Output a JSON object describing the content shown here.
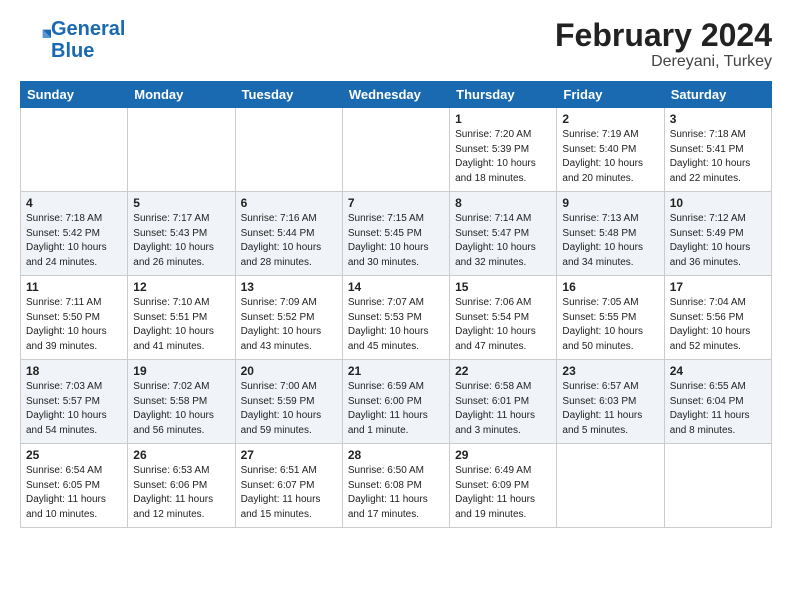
{
  "header": {
    "logo_line1": "General",
    "logo_line2": "Blue",
    "title": "February 2024",
    "subtitle": "Dereyani, Turkey"
  },
  "days_of_week": [
    "Sunday",
    "Monday",
    "Tuesday",
    "Wednesday",
    "Thursday",
    "Friday",
    "Saturday"
  ],
  "weeks": [
    [
      {
        "day": "",
        "info": ""
      },
      {
        "day": "",
        "info": ""
      },
      {
        "day": "",
        "info": ""
      },
      {
        "day": "",
        "info": ""
      },
      {
        "day": "1",
        "info": "Sunrise: 7:20 AM\nSunset: 5:39 PM\nDaylight: 10 hours\nand 18 minutes."
      },
      {
        "day": "2",
        "info": "Sunrise: 7:19 AM\nSunset: 5:40 PM\nDaylight: 10 hours\nand 20 minutes."
      },
      {
        "day": "3",
        "info": "Sunrise: 7:18 AM\nSunset: 5:41 PM\nDaylight: 10 hours\nand 22 minutes."
      }
    ],
    [
      {
        "day": "4",
        "info": "Sunrise: 7:18 AM\nSunset: 5:42 PM\nDaylight: 10 hours\nand 24 minutes."
      },
      {
        "day": "5",
        "info": "Sunrise: 7:17 AM\nSunset: 5:43 PM\nDaylight: 10 hours\nand 26 minutes."
      },
      {
        "day": "6",
        "info": "Sunrise: 7:16 AM\nSunset: 5:44 PM\nDaylight: 10 hours\nand 28 minutes."
      },
      {
        "day": "7",
        "info": "Sunrise: 7:15 AM\nSunset: 5:45 PM\nDaylight: 10 hours\nand 30 minutes."
      },
      {
        "day": "8",
        "info": "Sunrise: 7:14 AM\nSunset: 5:47 PM\nDaylight: 10 hours\nand 32 minutes."
      },
      {
        "day": "9",
        "info": "Sunrise: 7:13 AM\nSunset: 5:48 PM\nDaylight: 10 hours\nand 34 minutes."
      },
      {
        "day": "10",
        "info": "Sunrise: 7:12 AM\nSunset: 5:49 PM\nDaylight: 10 hours\nand 36 minutes."
      }
    ],
    [
      {
        "day": "11",
        "info": "Sunrise: 7:11 AM\nSunset: 5:50 PM\nDaylight: 10 hours\nand 39 minutes."
      },
      {
        "day": "12",
        "info": "Sunrise: 7:10 AM\nSunset: 5:51 PM\nDaylight: 10 hours\nand 41 minutes."
      },
      {
        "day": "13",
        "info": "Sunrise: 7:09 AM\nSunset: 5:52 PM\nDaylight: 10 hours\nand 43 minutes."
      },
      {
        "day": "14",
        "info": "Sunrise: 7:07 AM\nSunset: 5:53 PM\nDaylight: 10 hours\nand 45 minutes."
      },
      {
        "day": "15",
        "info": "Sunrise: 7:06 AM\nSunset: 5:54 PM\nDaylight: 10 hours\nand 47 minutes."
      },
      {
        "day": "16",
        "info": "Sunrise: 7:05 AM\nSunset: 5:55 PM\nDaylight: 10 hours\nand 50 minutes."
      },
      {
        "day": "17",
        "info": "Sunrise: 7:04 AM\nSunset: 5:56 PM\nDaylight: 10 hours\nand 52 minutes."
      }
    ],
    [
      {
        "day": "18",
        "info": "Sunrise: 7:03 AM\nSunset: 5:57 PM\nDaylight: 10 hours\nand 54 minutes."
      },
      {
        "day": "19",
        "info": "Sunrise: 7:02 AM\nSunset: 5:58 PM\nDaylight: 10 hours\nand 56 minutes."
      },
      {
        "day": "20",
        "info": "Sunrise: 7:00 AM\nSunset: 5:59 PM\nDaylight: 10 hours\nand 59 minutes."
      },
      {
        "day": "21",
        "info": "Sunrise: 6:59 AM\nSunset: 6:00 PM\nDaylight: 11 hours\nand 1 minute."
      },
      {
        "day": "22",
        "info": "Sunrise: 6:58 AM\nSunset: 6:01 PM\nDaylight: 11 hours\nand 3 minutes."
      },
      {
        "day": "23",
        "info": "Sunrise: 6:57 AM\nSunset: 6:03 PM\nDaylight: 11 hours\nand 5 minutes."
      },
      {
        "day": "24",
        "info": "Sunrise: 6:55 AM\nSunset: 6:04 PM\nDaylight: 11 hours\nand 8 minutes."
      }
    ],
    [
      {
        "day": "25",
        "info": "Sunrise: 6:54 AM\nSunset: 6:05 PM\nDaylight: 11 hours\nand 10 minutes."
      },
      {
        "day": "26",
        "info": "Sunrise: 6:53 AM\nSunset: 6:06 PM\nDaylight: 11 hours\nand 12 minutes."
      },
      {
        "day": "27",
        "info": "Sunrise: 6:51 AM\nSunset: 6:07 PM\nDaylight: 11 hours\nand 15 minutes."
      },
      {
        "day": "28",
        "info": "Sunrise: 6:50 AM\nSunset: 6:08 PM\nDaylight: 11 hours\nand 17 minutes."
      },
      {
        "day": "29",
        "info": "Sunrise: 6:49 AM\nSunset: 6:09 PM\nDaylight: 11 hours\nand 19 minutes."
      },
      {
        "day": "",
        "info": ""
      },
      {
        "day": "",
        "info": ""
      }
    ]
  ]
}
